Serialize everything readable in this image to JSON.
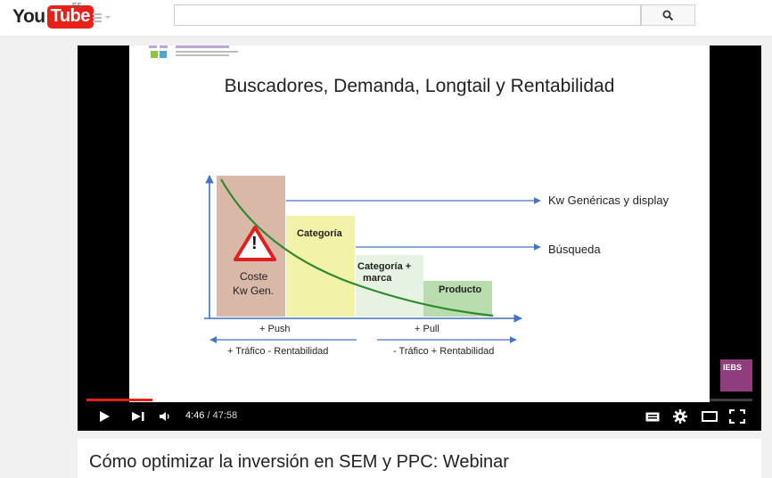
{
  "masthead": {
    "logo_you": "You",
    "logo_tube": "Tube",
    "region": "ES",
    "search_placeholder": ""
  },
  "slide": {
    "title": "Buscadores, Demanda, Longtail y Rentabilidad",
    "labels": {
      "coste": "Coste",
      "kw_gen": "Kw Gen.",
      "categoria": "Categoría",
      "categoria_marca_1": "Categoría +",
      "categoria_marca_2": "marca",
      "producto": "Producto",
      "kw_genericas": "Kw Genéricas y display",
      "busqueda": "Búsqueda",
      "push": "+ Push",
      "pull": "+ Pull",
      "trafico_left": "+ Tráfico - Rentabilidad",
      "trafico_right": "- Tráfico + Rentabilidad",
      "warning": "!"
    },
    "watermark": "IEBS"
  },
  "player": {
    "current_time": "4:46",
    "separator": " / ",
    "duration": "47:58",
    "progress_played_fraction": 0.099,
    "progress_buffered_fraction": 0.145
  },
  "video": {
    "title": "Cómo optimizar la inversión en SEM y PPC: Webinar"
  },
  "icons": {
    "search": "search-icon",
    "play": "play-icon",
    "next": "next-icon",
    "volume": "volume-icon",
    "subtitles": "subtitles-icon",
    "settings": "gear-icon",
    "theater": "theater-icon",
    "fullscreen": "fullscreen-icon"
  },
  "colors": {
    "brand_red": "#e62117",
    "bar_brown": "#d9b8a8",
    "bar_yellow": "#f2f2a8",
    "bar_light_green": "#e6f2e2",
    "bar_green": "#b8dcae",
    "curve_green": "#2f8a2f",
    "arrow_blue": "#4472c4"
  }
}
